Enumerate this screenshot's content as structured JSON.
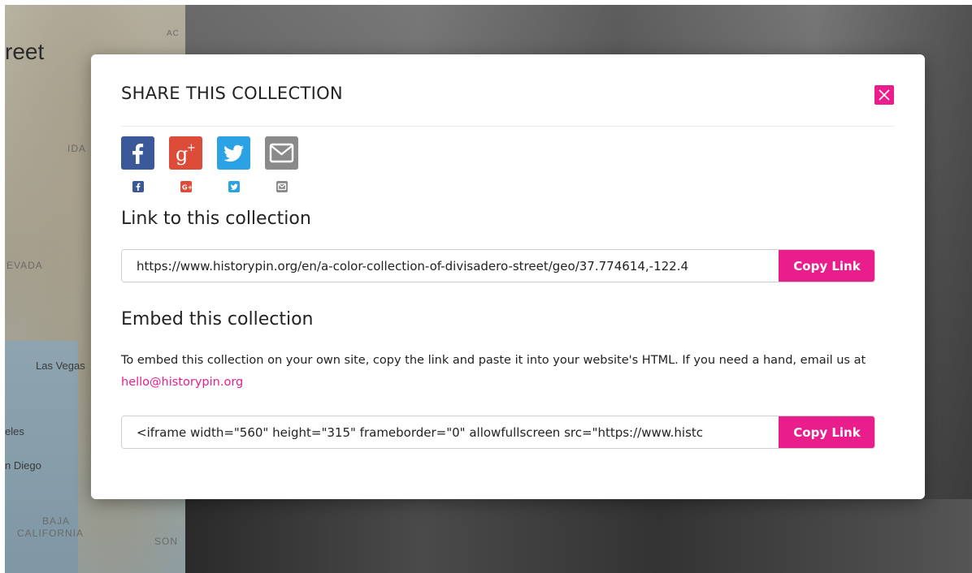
{
  "background": {
    "page_title_fragment": "reet",
    "map_labels": [
      "IDA",
      "EVADA",
      "Las Vegas",
      "eles",
      "n Diego",
      "BAJA",
      "CALIFORNIA",
      "SON",
      "AC"
    ]
  },
  "modal": {
    "title": "SHARE THIS COLLECTION",
    "share_buttons": [
      {
        "name": "facebook",
        "icon": "facebook-icon",
        "color": "#3b5998"
      },
      {
        "name": "google-plus",
        "icon": "google-plus-icon",
        "color": "#dd4b39"
      },
      {
        "name": "twitter",
        "icon": "twitter-icon",
        "color": "#2ba2e3"
      },
      {
        "name": "email",
        "icon": "email-icon",
        "color": "#8a8a8a"
      }
    ],
    "link_section": {
      "heading": "Link to this collection",
      "value": "https://www.historypin.org/en/a-color-collection-of-divisadero-street/geo/37.774614,-122.4",
      "button_label": "Copy Link"
    },
    "embed_section": {
      "heading": "Embed this collection",
      "description": "To embed this collection on your own site, copy the link and paste it into your website's HTML. If you need a hand, email us at ",
      "email": "hello@historypin.org",
      "value": "<iframe width=\"560\" height=\"315\" frameborder=\"0\" allowfullscreen src=\"https://www.histc",
      "button_label": "Copy Link"
    }
  },
  "colors": {
    "accent": "#e91e8c"
  }
}
